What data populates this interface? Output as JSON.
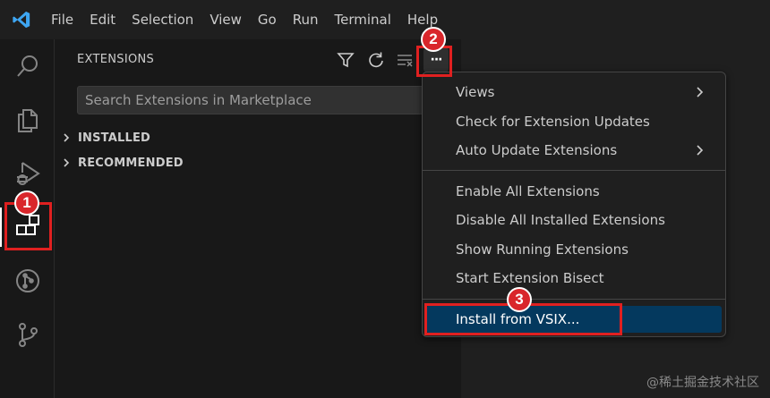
{
  "menubar": {
    "items": [
      "File",
      "Edit",
      "Selection",
      "View",
      "Go",
      "Run",
      "Terminal",
      "Help"
    ]
  },
  "activitybar": {
    "items": [
      "search-icon",
      "explorer-icon",
      "run-debug-icon",
      "extensions-icon",
      "git-graph-icon",
      "source-control-icon"
    ],
    "active": "extensions-icon"
  },
  "sidebar": {
    "title": "EXTENSIONS",
    "header_icons": [
      "filter-icon",
      "refresh-icon",
      "clear-icon",
      "more-actions-icon"
    ],
    "more_actions_label": "···",
    "search": {
      "placeholder": "Search Extensions in Marketplace",
      "value": ""
    },
    "sections": [
      {
        "label": "INSTALLED",
        "expanded": false
      },
      {
        "label": "RECOMMENDED",
        "expanded": false
      }
    ]
  },
  "context_menu": {
    "group1": [
      {
        "label": "Views",
        "submenu": true
      },
      {
        "label": "Check for Extension Updates",
        "submenu": false
      },
      {
        "label": "Auto Update Extensions",
        "submenu": true
      }
    ],
    "group2": [
      {
        "label": "Enable All Extensions"
      },
      {
        "label": "Disable All Installed Extensions"
      },
      {
        "label": "Show Running Extensions"
      },
      {
        "label": "Start Extension Bisect"
      }
    ],
    "group3": [
      {
        "label": "Install from VSIX...",
        "highlighted": true
      }
    ]
  },
  "annotations": {
    "badges": [
      "1",
      "2",
      "3"
    ],
    "color": "#d9262b"
  },
  "watermark": "@稀土掘金技术社区",
  "colors": {
    "vscode_logo": "#3ea6f2",
    "highlight": "#04395e",
    "annotation": "#e02020"
  }
}
